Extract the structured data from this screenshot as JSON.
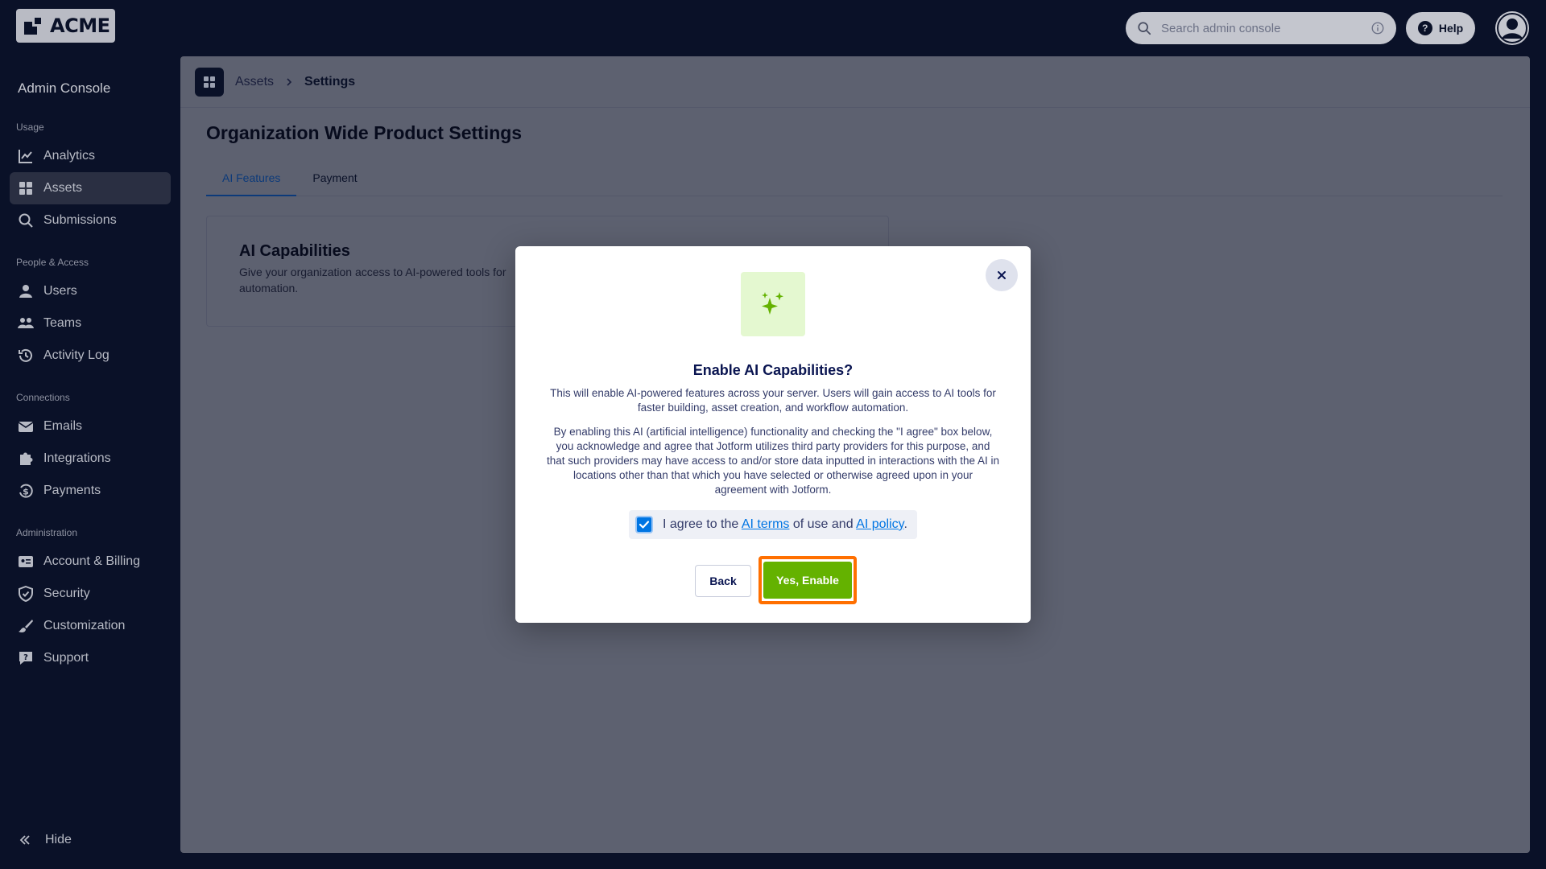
{
  "brand": {
    "name": "ACME"
  },
  "search": {
    "placeholder": "Search admin console"
  },
  "header": {
    "help_label": "Help"
  },
  "sidebar": {
    "title": "Admin Console",
    "sections": [
      {
        "label": "Usage"
      },
      {
        "label": "People & Access"
      },
      {
        "label": "Connections"
      },
      {
        "label": "Administration"
      }
    ],
    "items": [
      {
        "label": "Analytics",
        "icon": "chart-line-icon"
      },
      {
        "label": "Assets",
        "icon": "grid-icon",
        "active": true
      },
      {
        "label": "Submissions",
        "icon": "search-icon"
      },
      {
        "label": "Users",
        "icon": "user-icon"
      },
      {
        "label": "Teams",
        "icon": "users-icon"
      },
      {
        "label": "Activity Log",
        "icon": "history-icon"
      },
      {
        "label": "Emails",
        "icon": "envelope-icon"
      },
      {
        "label": "Integrations",
        "icon": "puzzle-icon"
      },
      {
        "label": "Payments",
        "icon": "dollar-icon"
      },
      {
        "label": "Account & Billing",
        "icon": "id-card-icon"
      },
      {
        "label": "Security",
        "icon": "shield-icon"
      },
      {
        "label": "Customization",
        "icon": "brush-icon"
      },
      {
        "label": "Support",
        "icon": "chat-icon"
      }
    ],
    "hide_label": "Hide"
  },
  "breadcrumb": {
    "parent": "Assets",
    "current": "Settings"
  },
  "page": {
    "title": "Organization Wide Product Settings",
    "tabs": [
      {
        "label": "AI Features",
        "active": true
      },
      {
        "label": "Payment",
        "active": false
      }
    ]
  },
  "card": {
    "title": "AI Capabilities",
    "description": "Give your organization access to AI-powered tools for automation."
  },
  "modal": {
    "title": "Enable AI Capabilities?",
    "paragraph1": "This will enable AI-powered features across your server. Users will gain access to AI tools for faster building, asset creation, and workflow automation.",
    "paragraph2": "By enabling this AI (artificial intelligence) functionality and checking the \"I agree\" box below, you acknowledge and agree that Jotform utilizes third party providers for this purpose, and that such providers may have access to and/or store data inputted in interactions with the AI in locations other than that which you have selected or otherwise agreed upon in your agreement with Jotform.",
    "agree_prefix": "I agree to the ",
    "ai_terms_link": "AI terms",
    "agree_middle": " of use and ",
    "ai_policy_link": "AI policy",
    "agree_suffix": ".",
    "checkbox_checked": true,
    "back_label": "Back",
    "enable_label": "Yes, Enable"
  },
  "colors": {
    "accent_green": "#64b200",
    "highlight_orange": "#ff6f00",
    "link_blue": "#0075e3",
    "sidebar_bg": "#0a1128"
  }
}
